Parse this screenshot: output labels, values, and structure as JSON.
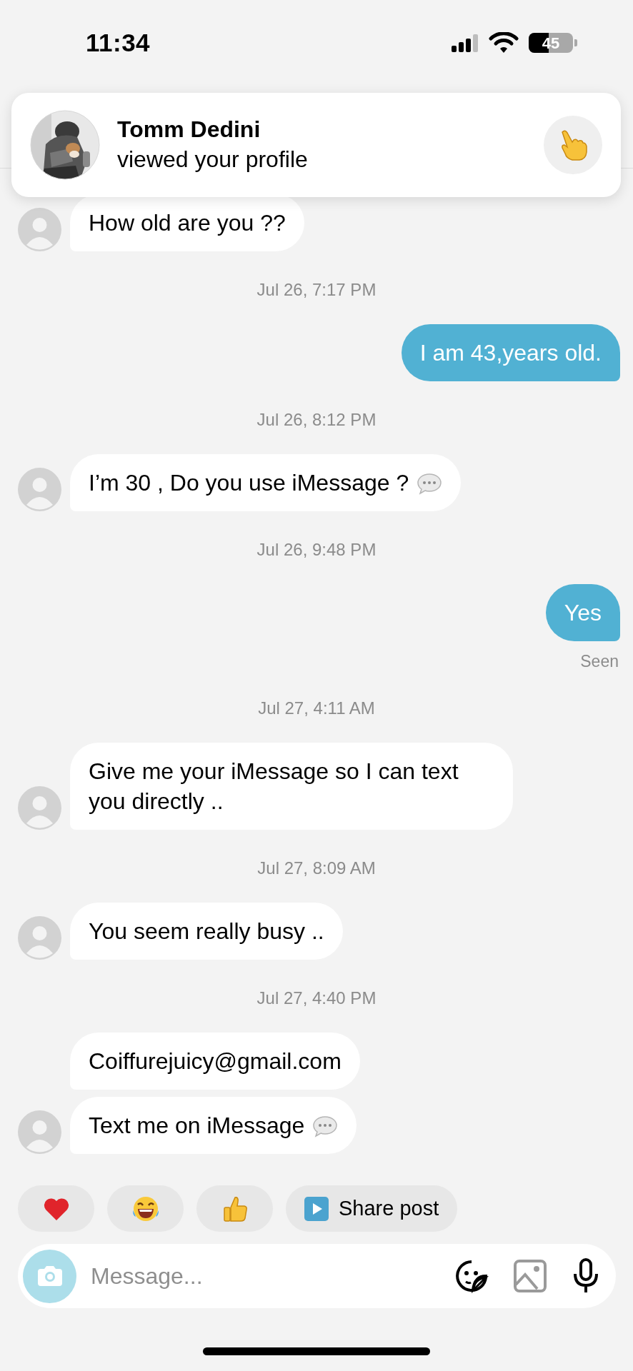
{
  "status_bar": {
    "time": "11:34",
    "battery": "45"
  },
  "notification": {
    "name": "Tomm Dedini",
    "text": "viewed your profile"
  },
  "messages": [
    {
      "kind": "received",
      "text": "How old are you ??",
      "avatar": true
    },
    {
      "kind": "timestamp",
      "text": "Jul 26, 7:17 PM"
    },
    {
      "kind": "sent",
      "text": "I am 43,years old."
    },
    {
      "kind": "timestamp",
      "text": "Jul 26, 8:12 PM"
    },
    {
      "kind": "received",
      "text": "I’m 30 , Do you use iMessage ?",
      "avatar": true,
      "speech_icon": true
    },
    {
      "kind": "timestamp",
      "text": "Jul 26, 9:48 PM"
    },
    {
      "kind": "sent",
      "text": "Yes"
    },
    {
      "kind": "status",
      "text": "Seen"
    },
    {
      "kind": "timestamp",
      "text": "Jul 27, 4:11 AM"
    },
    {
      "kind": "received",
      "text": "Give me your iMessage so I can text you directly ..",
      "avatar": true
    },
    {
      "kind": "timestamp",
      "text": "Jul 27, 8:09 AM"
    },
    {
      "kind": "received",
      "text": "You seem really busy ..",
      "avatar": true
    },
    {
      "kind": "timestamp",
      "text": "Jul 27, 4:40 PM"
    },
    {
      "kind": "received",
      "text": "Coiffurejuicy@gmail.com",
      "avatar": false
    },
    {
      "kind": "received",
      "text": "Text me on iMessage",
      "avatar": true,
      "speech_icon": true
    }
  ],
  "quick_replies": [
    {
      "kind": "heart"
    },
    {
      "kind": "laughing"
    },
    {
      "kind": "thumbs-up"
    },
    {
      "kind": "share",
      "label": "Share post"
    }
  ],
  "composer": {
    "placeholder": "Message..."
  }
}
